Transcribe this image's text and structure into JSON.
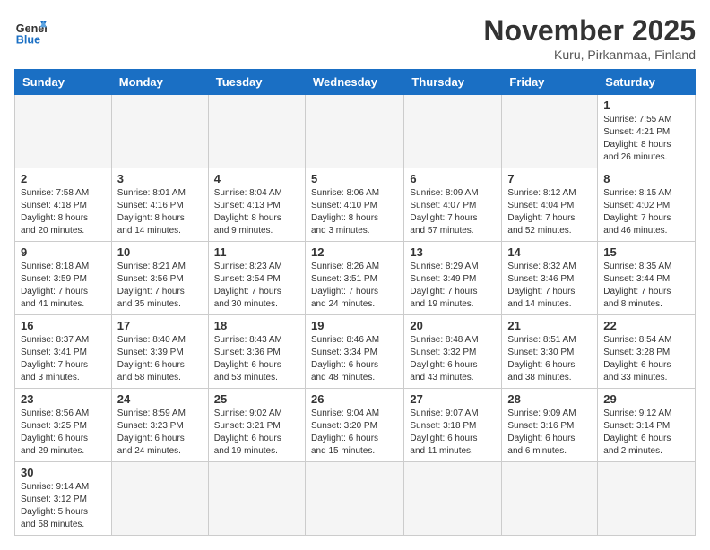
{
  "header": {
    "logo_general": "General",
    "logo_blue": "Blue",
    "month_year": "November 2025",
    "location": "Kuru, Pirkanmaa, Finland"
  },
  "days_of_week": [
    "Sunday",
    "Monday",
    "Tuesday",
    "Wednesday",
    "Thursday",
    "Friday",
    "Saturday"
  ],
  "weeks": [
    [
      {
        "day": "",
        "info": ""
      },
      {
        "day": "",
        "info": ""
      },
      {
        "day": "",
        "info": ""
      },
      {
        "day": "",
        "info": ""
      },
      {
        "day": "",
        "info": ""
      },
      {
        "day": "",
        "info": ""
      },
      {
        "day": "1",
        "info": "Sunrise: 7:55 AM\nSunset: 4:21 PM\nDaylight: 8 hours\nand 26 minutes."
      }
    ],
    [
      {
        "day": "2",
        "info": "Sunrise: 7:58 AM\nSunset: 4:18 PM\nDaylight: 8 hours\nand 20 minutes."
      },
      {
        "day": "3",
        "info": "Sunrise: 8:01 AM\nSunset: 4:16 PM\nDaylight: 8 hours\nand 14 minutes."
      },
      {
        "day": "4",
        "info": "Sunrise: 8:04 AM\nSunset: 4:13 PM\nDaylight: 8 hours\nand 9 minutes."
      },
      {
        "day": "5",
        "info": "Sunrise: 8:06 AM\nSunset: 4:10 PM\nDaylight: 8 hours\nand 3 minutes."
      },
      {
        "day": "6",
        "info": "Sunrise: 8:09 AM\nSunset: 4:07 PM\nDaylight: 7 hours\nand 57 minutes."
      },
      {
        "day": "7",
        "info": "Sunrise: 8:12 AM\nSunset: 4:04 PM\nDaylight: 7 hours\nand 52 minutes."
      },
      {
        "day": "8",
        "info": "Sunrise: 8:15 AM\nSunset: 4:02 PM\nDaylight: 7 hours\nand 46 minutes."
      }
    ],
    [
      {
        "day": "9",
        "info": "Sunrise: 8:18 AM\nSunset: 3:59 PM\nDaylight: 7 hours\nand 41 minutes."
      },
      {
        "day": "10",
        "info": "Sunrise: 8:21 AM\nSunset: 3:56 PM\nDaylight: 7 hours\nand 35 minutes."
      },
      {
        "day": "11",
        "info": "Sunrise: 8:23 AM\nSunset: 3:54 PM\nDaylight: 7 hours\nand 30 minutes."
      },
      {
        "day": "12",
        "info": "Sunrise: 8:26 AM\nSunset: 3:51 PM\nDaylight: 7 hours\nand 24 minutes."
      },
      {
        "day": "13",
        "info": "Sunrise: 8:29 AM\nSunset: 3:49 PM\nDaylight: 7 hours\nand 19 minutes."
      },
      {
        "day": "14",
        "info": "Sunrise: 8:32 AM\nSunset: 3:46 PM\nDaylight: 7 hours\nand 14 minutes."
      },
      {
        "day": "15",
        "info": "Sunrise: 8:35 AM\nSunset: 3:44 PM\nDaylight: 7 hours\nand 8 minutes."
      }
    ],
    [
      {
        "day": "16",
        "info": "Sunrise: 8:37 AM\nSunset: 3:41 PM\nDaylight: 7 hours\nand 3 minutes."
      },
      {
        "day": "17",
        "info": "Sunrise: 8:40 AM\nSunset: 3:39 PM\nDaylight: 6 hours\nand 58 minutes."
      },
      {
        "day": "18",
        "info": "Sunrise: 8:43 AM\nSunset: 3:36 PM\nDaylight: 6 hours\nand 53 minutes."
      },
      {
        "day": "19",
        "info": "Sunrise: 8:46 AM\nSunset: 3:34 PM\nDaylight: 6 hours\nand 48 minutes."
      },
      {
        "day": "20",
        "info": "Sunrise: 8:48 AM\nSunset: 3:32 PM\nDaylight: 6 hours\nand 43 minutes."
      },
      {
        "day": "21",
        "info": "Sunrise: 8:51 AM\nSunset: 3:30 PM\nDaylight: 6 hours\nand 38 minutes."
      },
      {
        "day": "22",
        "info": "Sunrise: 8:54 AM\nSunset: 3:28 PM\nDaylight: 6 hours\nand 33 minutes."
      }
    ],
    [
      {
        "day": "23",
        "info": "Sunrise: 8:56 AM\nSunset: 3:25 PM\nDaylight: 6 hours\nand 29 minutes."
      },
      {
        "day": "24",
        "info": "Sunrise: 8:59 AM\nSunset: 3:23 PM\nDaylight: 6 hours\nand 24 minutes."
      },
      {
        "day": "25",
        "info": "Sunrise: 9:02 AM\nSunset: 3:21 PM\nDaylight: 6 hours\nand 19 minutes."
      },
      {
        "day": "26",
        "info": "Sunrise: 9:04 AM\nSunset: 3:20 PM\nDaylight: 6 hours\nand 15 minutes."
      },
      {
        "day": "27",
        "info": "Sunrise: 9:07 AM\nSunset: 3:18 PM\nDaylight: 6 hours\nand 11 minutes."
      },
      {
        "day": "28",
        "info": "Sunrise: 9:09 AM\nSunset: 3:16 PM\nDaylight: 6 hours\nand 6 minutes."
      },
      {
        "day": "29",
        "info": "Sunrise: 9:12 AM\nSunset: 3:14 PM\nDaylight: 6 hours\nand 2 minutes."
      }
    ],
    [
      {
        "day": "30",
        "info": "Sunrise: 9:14 AM\nSunset: 3:12 PM\nDaylight: 5 hours\nand 58 minutes."
      },
      {
        "day": "",
        "info": ""
      },
      {
        "day": "",
        "info": ""
      },
      {
        "day": "",
        "info": ""
      },
      {
        "day": "",
        "info": ""
      },
      {
        "day": "",
        "info": ""
      },
      {
        "day": "",
        "info": ""
      }
    ]
  ]
}
